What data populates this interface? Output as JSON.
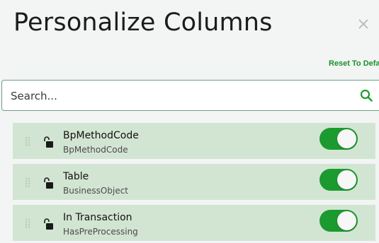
{
  "dialog": {
    "title": "Personalize Columns",
    "close_icon": "close-icon",
    "reset_label": "Reset To Default"
  },
  "search": {
    "placeholder": "Search...",
    "value": "",
    "icon": "search-icon"
  },
  "columns": [
    {
      "label": "BpMethodCode",
      "sublabel": "BpMethodCode",
      "locked": false,
      "visible": true
    },
    {
      "label": "Table",
      "sublabel": "BusinessObject",
      "locked": false,
      "visible": true
    },
    {
      "label": "In Transaction",
      "sublabel": "HasPreProcessing",
      "locked": false,
      "visible": true
    }
  ],
  "colors": {
    "accent": "#1b9a2f",
    "row_background": "#d2e5d3",
    "panel_background": "#f2f5f3",
    "reset_link": "#1a8f2e"
  }
}
